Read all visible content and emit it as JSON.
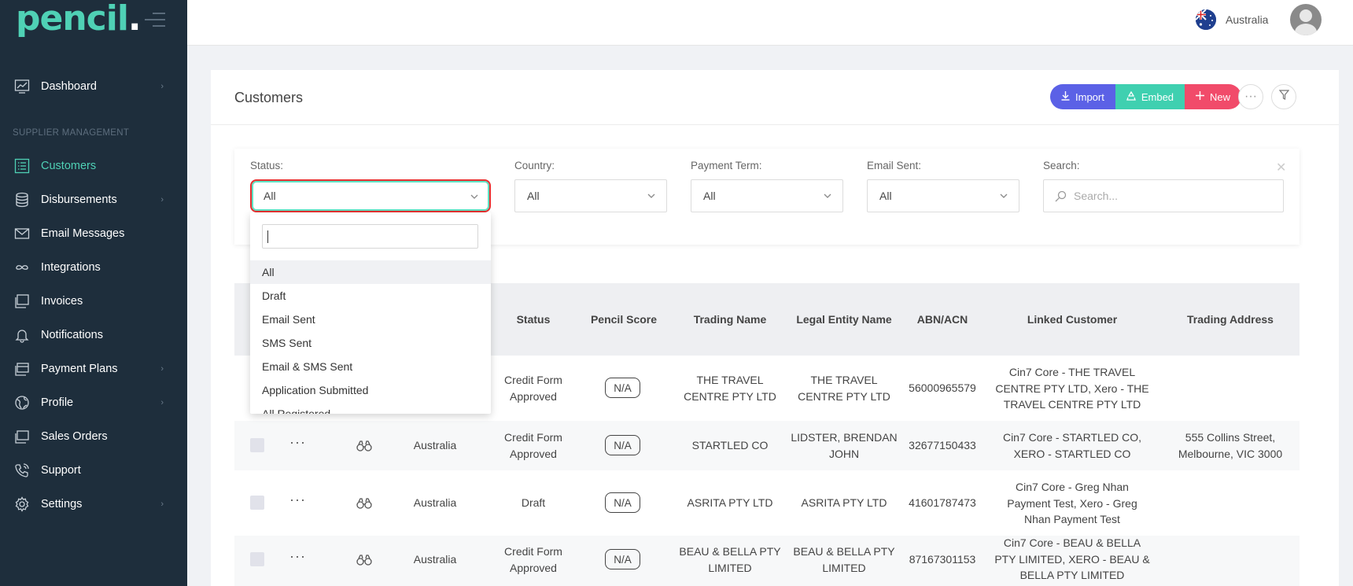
{
  "brand": {
    "logo_text": "pencil",
    "logo_dot": "."
  },
  "sidebar": {
    "section_label": "SUPPLIER MANAGEMENT",
    "items": [
      {
        "label": "Dashboard",
        "icon": "dashboard-chart-icon",
        "has_chevron": true
      },
      {
        "label": "Customers",
        "icon": "list-icon",
        "active": true
      },
      {
        "label": "Disbursements",
        "icon": "coins-stack-icon",
        "has_chevron": true
      },
      {
        "label": "Email Messages",
        "icon": "envelope-icon"
      },
      {
        "label": "Integrations",
        "icon": "infinity-icon"
      },
      {
        "label": "Invoices",
        "icon": "invoice-icon"
      },
      {
        "label": "Notifications",
        "icon": "bell-icon"
      },
      {
        "label": "Payment Plans",
        "icon": "payment-plan-icon",
        "has_chevron": true
      },
      {
        "label": "Profile",
        "icon": "globe-icon",
        "has_chevron": true
      },
      {
        "label": "Sales Orders",
        "icon": "sales-orders-icon"
      },
      {
        "label": "Support",
        "icon": "support-phone-icon"
      },
      {
        "label": "Settings",
        "icon": "gear-icon",
        "has_chevron": true
      }
    ]
  },
  "topbar": {
    "country": "Australia",
    "flag_icon": "australia-flag-icon"
  },
  "page": {
    "title": "Customers",
    "buttons": {
      "import": "Import",
      "embed": "Embed",
      "new": "New"
    }
  },
  "filters": {
    "status": {
      "label": "Status:",
      "value": "All"
    },
    "country": {
      "label": "Country:",
      "value": "All"
    },
    "payment_term": {
      "label": "Payment Term:",
      "value": "All"
    },
    "email_sent": {
      "label": "Email Sent:",
      "value": "All"
    },
    "search": {
      "label": "Search:",
      "placeholder": "Search..."
    }
  },
  "status_dropdown": {
    "search_value": "",
    "options": [
      "All",
      "Draft",
      "Email Sent",
      "SMS Sent",
      "Email & SMS Sent",
      "Application Submitted",
      "All Registered"
    ],
    "selected": "All"
  },
  "table": {
    "columns": [
      "Status",
      "Pencil Score",
      "Trading Name",
      "Legal Entity Name",
      "ABN/ACN",
      "Linked Customer",
      "Trading Address"
    ],
    "rows": [
      {
        "country": "",
        "status": "Credit Form Approved",
        "score": "N/A",
        "trading_name": "THE TRAVEL CENTRE PTY LTD",
        "legal_name": "THE TRAVEL CENTRE PTY LTD",
        "abn": "56000965579",
        "linked": "Cin7 Core - THE TRAVEL CENTRE PTY LTD, Xero - THE TRAVEL CENTRE PTY LTD",
        "address": ""
      },
      {
        "country": "Australia",
        "status": "Credit Form Approved",
        "score": "N/A",
        "trading_name": "STARTLED CO",
        "legal_name": "LIDSTER, BRENDAN JOHN",
        "abn": "32677150433",
        "linked": "Cin7 Core - STARTLED CO, XERO - STARTLED CO",
        "address": "555 Collins Street, Melbourne, VIC 3000"
      },
      {
        "country": "Australia",
        "status": "Draft",
        "score": "N/A",
        "trading_name": "ASRITA PTY LTD",
        "legal_name": "ASRITA PTY LTD",
        "abn": "41601787473",
        "linked": "Cin7 Core - Greg Nhan Payment Test, Xero - Greg Nhan Payment Test",
        "address": ""
      },
      {
        "country": "Australia",
        "status": "Credit Form Approved",
        "score": "N/A",
        "trading_name": "BEAU & BELLA PTY LIMITED",
        "legal_name": "BEAU & BELLA PTY LIMITED",
        "abn": "87167301153",
        "linked": "Cin7 Core - BEAU & BELLA PTY LIMITED, XERO - BEAU & BELLA PTY LIMITED",
        "address": ""
      }
    ]
  },
  "colors": {
    "sidebar_bg": "#1e2e3c",
    "accent": "#4fd1b5",
    "import_btn": "#5b61e6",
    "embed_btn": "#3fd0b0",
    "new_btn": "#f14b6a",
    "focus_outline": "#e63030"
  }
}
